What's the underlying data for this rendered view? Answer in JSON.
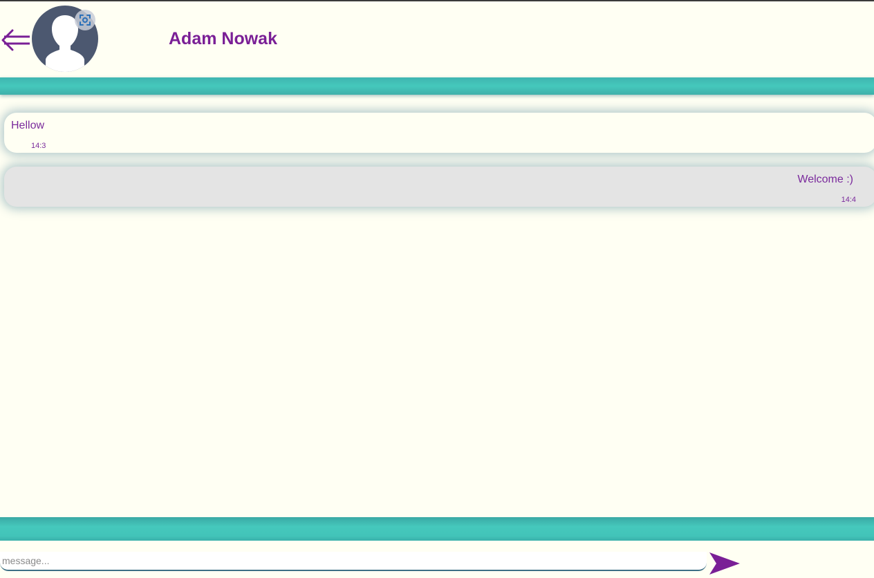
{
  "header": {
    "contact_name": "Adam Nowak",
    "back_icon": "back-arrow-icon",
    "avatar_icon": "user-silhouette-icon",
    "avatar_edit_icon": "camera-focus-icon"
  },
  "messages": [
    {
      "direction": "incoming",
      "text": "Hellow",
      "time": "14:3"
    },
    {
      "direction": "outgoing",
      "text": "Welcome :)",
      "time": "14:4"
    }
  ],
  "composer": {
    "placeholder": "message...",
    "value": "",
    "send_icon": "send-arrow-icon"
  },
  "colors": {
    "accent_purple": "#7a1f96",
    "teal_bar": "#45c8bc",
    "background": "#fffff3",
    "outgoing_bubble": "#e4e4e4",
    "avatar_bg": "#4c5870"
  }
}
